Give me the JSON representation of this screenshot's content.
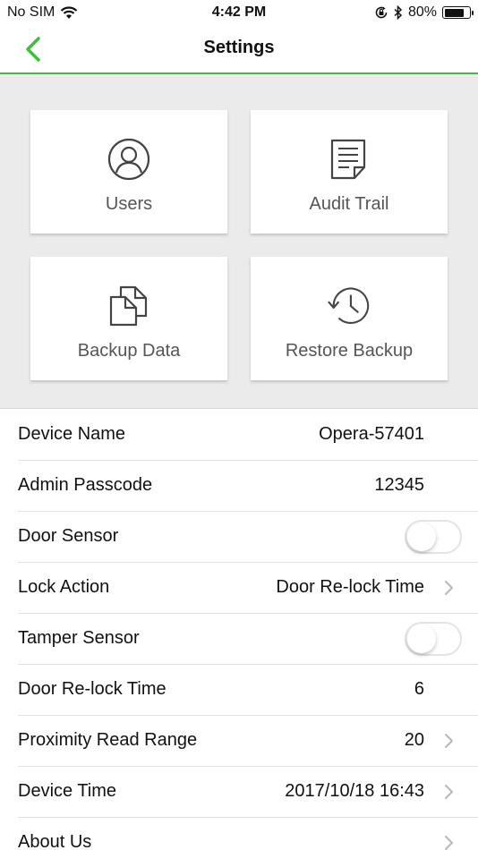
{
  "status": {
    "carrier": "No SIM",
    "time": "4:42 PM",
    "battery_percent": "80%",
    "battery_level": 0.8,
    "icons": [
      "wifi-icon",
      "orientation-lock-icon",
      "bluetooth-icon",
      "battery-icon"
    ]
  },
  "nav": {
    "title": "Settings",
    "back_icon": "chevron-left-icon",
    "accent_color": "#3ac13a"
  },
  "tiles": [
    {
      "label": "Users",
      "icon": "user-icon"
    },
    {
      "label": "Audit Trail",
      "icon": "document-icon"
    },
    {
      "label": "Backup Data",
      "icon": "copy-icon"
    },
    {
      "label": "Restore Backup",
      "icon": "history-icon"
    }
  ],
  "settings": {
    "device_name": {
      "label": "Device Name",
      "value": "Opera-57401"
    },
    "admin_passcode": {
      "label": "Admin Passcode",
      "value": "12345"
    },
    "door_sensor": {
      "label": "Door Sensor",
      "enabled": false
    },
    "lock_action": {
      "label": "Lock Action",
      "value": "Door Re-lock Time"
    },
    "tamper_sensor": {
      "label": "Tamper Sensor",
      "enabled": false
    },
    "door_relock_time": {
      "label": "Door Re-lock Time",
      "value": "6"
    },
    "proximity_read_range": {
      "label": "Proximity Read Range",
      "value": "20"
    },
    "device_time": {
      "label": "Device Time",
      "value": "2017/10/18 16:43"
    },
    "about_us": {
      "label": "About Us"
    }
  }
}
